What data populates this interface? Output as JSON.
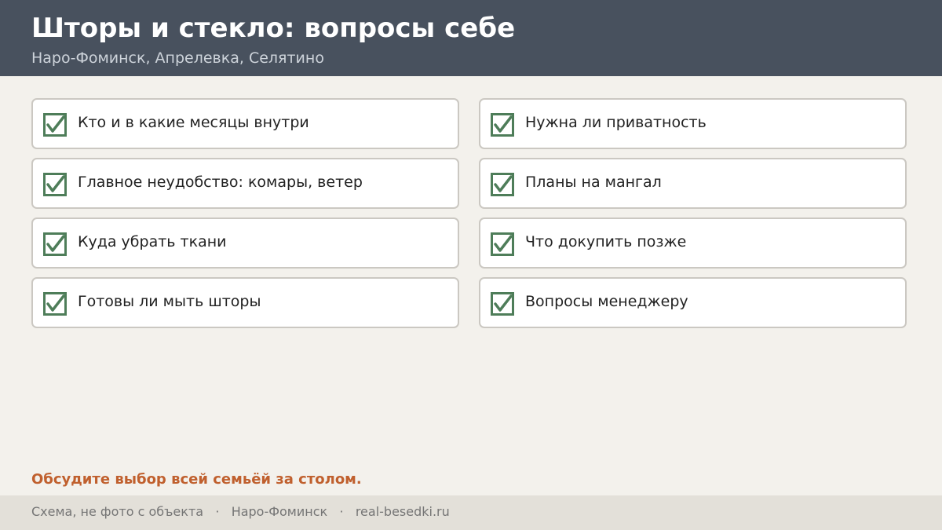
{
  "header": {
    "title": "Шторы и стекло: вопросы себе",
    "subtitle": "Наро-Фоминск, Апрелевка, Селятино"
  },
  "colors": {
    "header_bg": "#48515e",
    "page_bg": "#f3f1ec",
    "check_green": "#4e7d59",
    "accent_orange": "#c0602e",
    "footer_bg": "#e3e0d9"
  },
  "checklist": {
    "icon": "checked-checkbox-icon",
    "left": [
      {
        "label": "Кто и в какие месяцы внутри",
        "checked": true
      },
      {
        "label": "Главное неудобство: комары, ветер",
        "checked": true
      },
      {
        "label": "Куда убрать ткани",
        "checked": true
      },
      {
        "label": "Готовы ли мыть шторы",
        "checked": true
      }
    ],
    "right": [
      {
        "label": "Нужна ли приватность",
        "checked": true
      },
      {
        "label": "Планы на мангал",
        "checked": true
      },
      {
        "label": "Что докупить позже",
        "checked": true
      },
      {
        "label": "Вопросы менеджеру",
        "checked": true
      }
    ]
  },
  "note": "Обсудите выбор всей семьёй за столом.",
  "footer": {
    "caption": "Схема, не фото с объекта",
    "city": "Наро-Фоминск",
    "site": "real-besedki.ru",
    "separator": "·"
  }
}
